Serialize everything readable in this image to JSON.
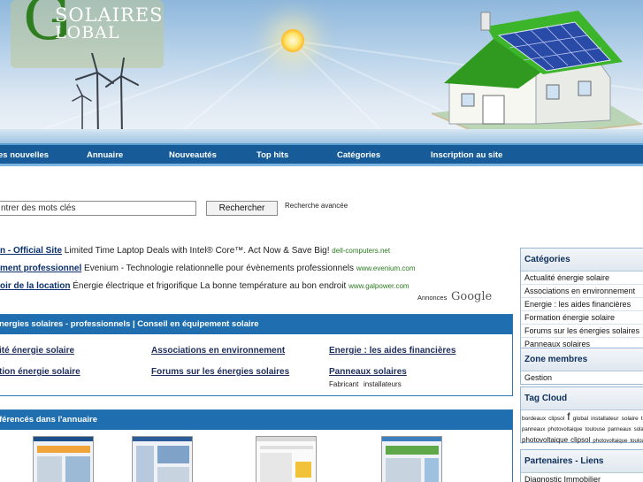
{
  "logo": {
    "letter": "G",
    "line1": "SOLAIRES",
    "line2": "LOBAL"
  },
  "nav": [
    {
      "label": "es nouvelles"
    },
    {
      "label": "Annuaire"
    },
    {
      "label": "Nouveautés"
    },
    {
      "label": "Top hits"
    },
    {
      "label": "Catégories"
    },
    {
      "label": "Inscription au site"
    }
  ],
  "search": {
    "value": "ntrer des mots clés",
    "button": "Rechercher",
    "advanced": "Recherche avancée"
  },
  "ads": [
    {
      "title": "n - Official Site",
      "text": " Limited Time Laptop Deals with Intel® Core™. Act Now & Save Big! ",
      "url": "dell-computers.net"
    },
    {
      "title": "ment professionnel",
      "text": " Evenium - Technologie relationnelle pour évènements professionnels ",
      "url": "www.evenium.com"
    },
    {
      "title": "oir de la location",
      "text": " Énergie électrique et frigorifique La bonne température au bon endroit ",
      "url": "www.galpower.com"
    }
  ],
  "ads_credit": {
    "label": "Annonces",
    "brand": "Google"
  },
  "categories_box": {
    "title": "nergies solaires - professionnels | Conseil en équipement solaire",
    "links": [
      {
        "label": "ité énergie solaire"
      },
      {
        "label": "Associations en environnement"
      },
      {
        "label": "Energie : les aides financières"
      },
      {
        "label": "tion énergie solaire"
      },
      {
        "label": "Forums sur les énergies solaires"
      },
      {
        "label": "Panneaux solaires"
      }
    ],
    "sublinks": [
      {
        "label": "Fabricant"
      },
      {
        "label": "installateurs"
      }
    ]
  },
  "annuaire_box": {
    "title": "férencés dans l'annuaire"
  },
  "sidebar": {
    "categories": {
      "title": "Catégories",
      "items": [
        "Actualité énergie solaire",
        "Associations en environnement",
        "Energie : les aides financières",
        "Formation énergie solaire",
        "Forums sur les énergies solaires",
        "Panneaux solaires"
      ]
    },
    "members": {
      "title": "Zone membres",
      "items": [
        "Gestion"
      ]
    },
    "tags": {
      "title": "Tag Cloud",
      "line1": [
        "bordeaux",
        "clipsol",
        "f",
        "global",
        "installateur",
        "solaire",
        "toulouse"
      ],
      "line2": [
        "panneaux",
        "photovoltaique",
        "toulouse",
        "panneaux",
        "solaire"
      ],
      "line3": [
        "photovoltaique",
        "clipsol",
        "photovoltaique",
        "toulouse"
      ]
    },
    "partners": {
      "title": "Partenaires - Liens",
      "items": [
        "Diagnostic Immobilier"
      ]
    }
  },
  "colors": {
    "nav": "#175c98",
    "box_header": "#1f6fb0",
    "link": "#1d2c5a",
    "ad_url": "#2a7a1f"
  }
}
